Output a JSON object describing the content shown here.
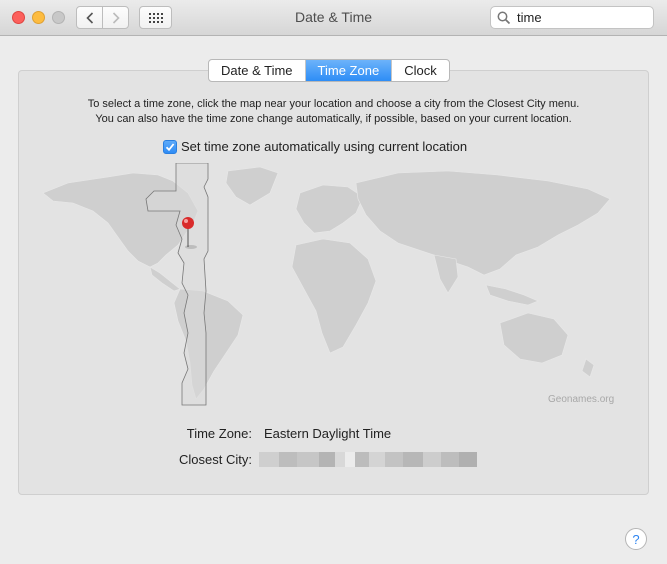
{
  "window": {
    "title": "Date & Time"
  },
  "search": {
    "value": "time"
  },
  "tabs": [
    {
      "label": "Date & Time"
    },
    {
      "label": "Time Zone"
    },
    {
      "label": "Clock"
    }
  ],
  "active_tab": "Time Zone",
  "instructions": {
    "line1": "To select a time zone, click the map near your location and choose a city from the Closest City menu.",
    "line2": "You can also have the time zone change automatically, if possible, based on your current location."
  },
  "auto_timezone": {
    "label": "Set time zone automatically using current location",
    "checked": true
  },
  "map": {
    "credit": "Geonames.org"
  },
  "info": {
    "timezone_label": "Time Zone:",
    "timezone_value": "Eastern Daylight Time",
    "city_label": "Closest City:"
  },
  "help": {
    "label": "?"
  },
  "colors": {
    "accent": "#2d8df6",
    "close": "#fc605c",
    "minimize": "#fdbc40",
    "pin": "#d92b2b"
  },
  "icons": {
    "back": "chevron-left-icon",
    "forward": "chevron-right-icon",
    "grid": "grid-icon",
    "search": "search-icon",
    "check": "checkmark-icon",
    "pin": "map-pin-icon"
  }
}
